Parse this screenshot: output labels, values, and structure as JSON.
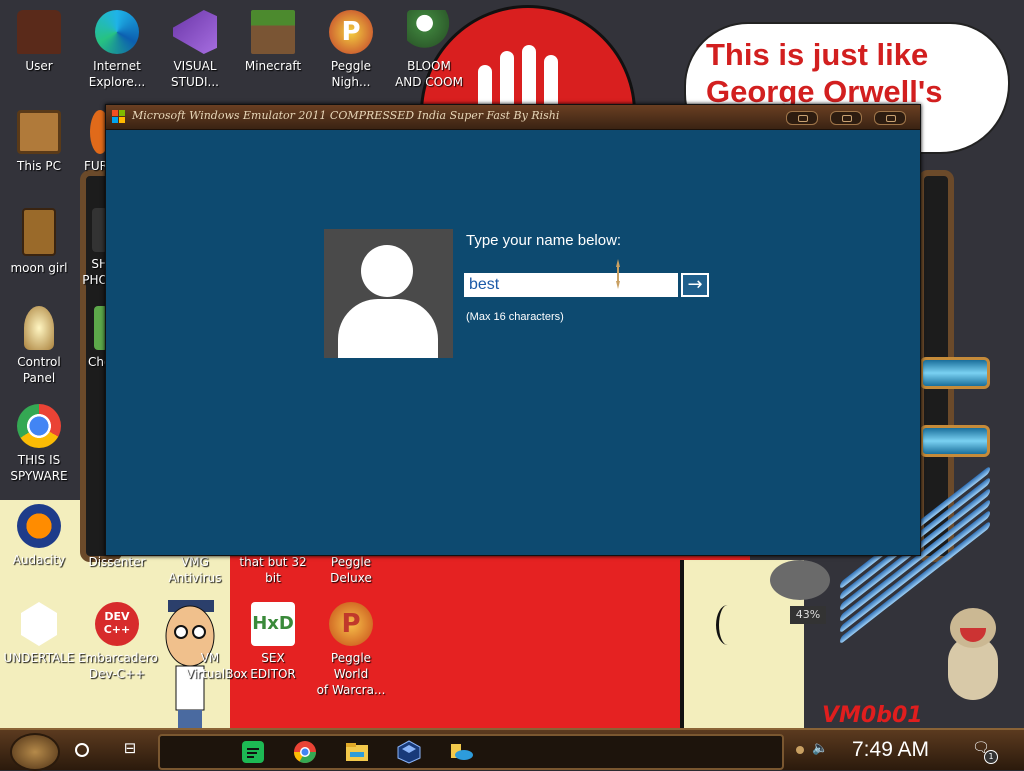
{
  "desktop": {
    "speech_bubble_text": "This is just like George Orwell's",
    "gauge_percent": "43%",
    "watermark": "VM0b01",
    "icons": [
      {
        "id": "user",
        "label": "User"
      },
      {
        "id": "internet-explorer",
        "label": "Internet\nExplore..."
      },
      {
        "id": "visual-studio",
        "label": "VISUAL\nSTUDI..."
      },
      {
        "id": "minecraft",
        "label": "Minecraft"
      },
      {
        "id": "peggle-nights",
        "label": "Peggle\nNigh..."
      },
      {
        "id": "bloom-and-coom",
        "label": "BLOOM\nAND COOM"
      },
      {
        "id": "this-pc",
        "label": "This PC"
      },
      {
        "id": "fur",
        "label": "FUR"
      },
      {
        "id": "moon-girl",
        "label": "moon girl"
      },
      {
        "id": "sh-pho",
        "label": "SH\nPHO"
      },
      {
        "id": "control-panel",
        "label": "Control Panel"
      },
      {
        "id": "cho",
        "label": "Cho"
      },
      {
        "id": "chrome-spyware",
        "label": "THIS IS\nSPYWARE"
      },
      {
        "id": "audacity",
        "label": "Audacity"
      },
      {
        "id": "dissenter",
        "label": "Dissenter"
      },
      {
        "id": "vmg-antivirus",
        "label": "VMG\nAntivirus"
      },
      {
        "id": "that-but-32-bit",
        "label": "that but 32\nbit"
      },
      {
        "id": "peggle-deluxe",
        "label": "Peggle\nDeluxe"
      },
      {
        "id": "undertale",
        "label": "UNDERTALE"
      },
      {
        "id": "embarcadero-dev-cpp",
        "label": "Embarcadero\nDev-C++"
      },
      {
        "id": "vm-virtualbox",
        "label": "VM\nVirtualBox"
      },
      {
        "id": "hex-editor",
        "label": "SEX\nEDITOR"
      },
      {
        "id": "peggle-world-of-warcraft",
        "label": "Peggle World\nof Warcra..."
      }
    ],
    "dev_cpp_glyph": "DEV\nC++",
    "hex_glyph": "HxD",
    "peggle_glyph": "P"
  },
  "window": {
    "title": "Microsoft Windows Emulator 2011 COMPRESSED India Super Fast By Rishi",
    "prompt": "Type your name below:",
    "input_value": "best",
    "submit_arrow": "→",
    "hint": "(Max 16 characters)",
    "colors": {
      "background": "#0d4a70",
      "avatar_bg": "#4a4a4a",
      "input_text": "#1c5aa8"
    }
  },
  "taskbar": {
    "search_icon": "cortana-circle-icon",
    "taskview_glyph": "⊟",
    "apps": [
      "spotify-icon",
      "chrome-icon",
      "file-explorer-icon",
      "virtualbox-icon",
      "onedrive-icon"
    ],
    "volume_glyph": "🔈",
    "time": "7:49 AM",
    "notification_glyph": "🗨",
    "notification_count": "1"
  }
}
